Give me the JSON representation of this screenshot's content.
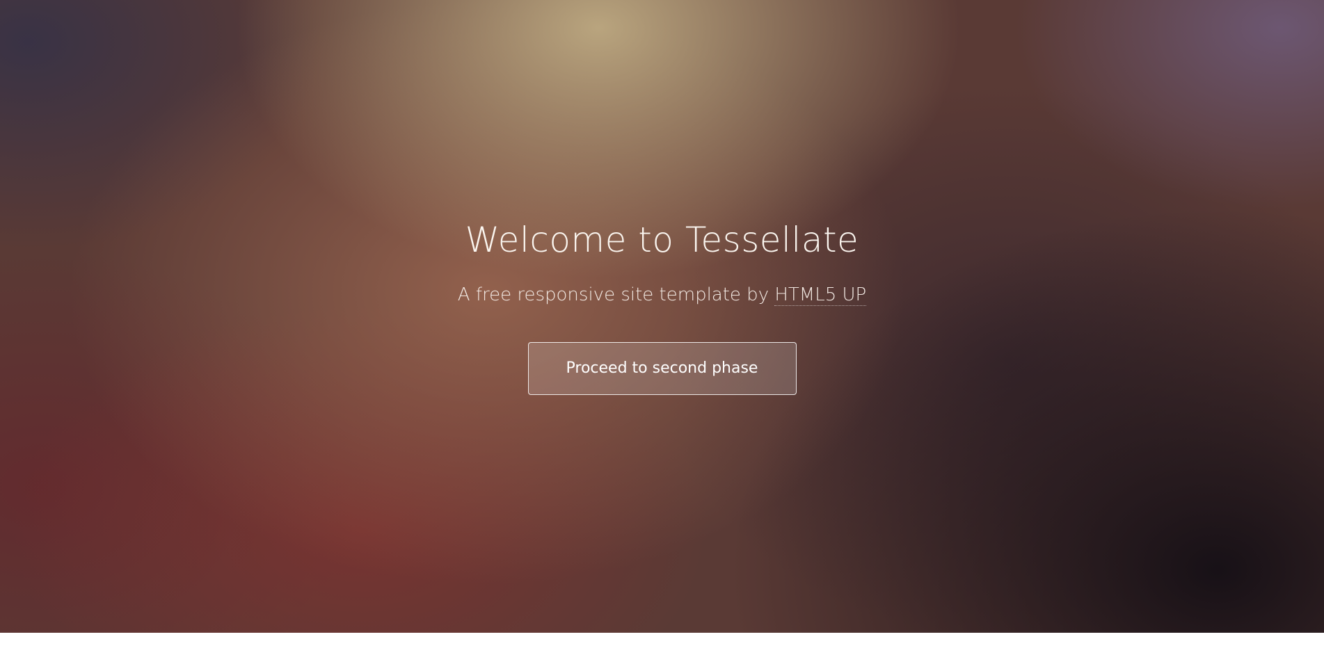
{
  "hero": {
    "title": "Welcome to Tessellate",
    "subtitle_prefix": "A free responsive site template by ",
    "subtitle_link": "HTML5 UP",
    "button_label": "Proceed to second phase"
  }
}
